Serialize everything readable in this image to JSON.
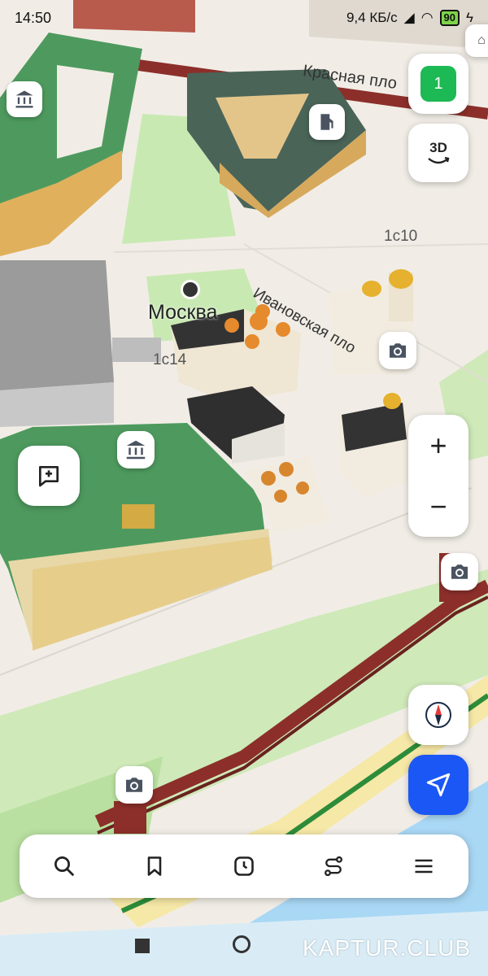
{
  "status_bar": {
    "time": "14:50",
    "network_speed": "9,4 КБ/с",
    "battery": "90"
  },
  "map": {
    "labels": {
      "krasnaya_square": "Красная пло",
      "ivanovskaya_square": "Ивановская пло",
      "building_1c10": "1с10",
      "building_1c14": "1с14",
      "moskva": "Москва"
    }
  },
  "controls": {
    "notifications_count": "1",
    "mode_3d": "3D",
    "zoom_in": "+",
    "zoom_out": "−"
  },
  "colors": {
    "accent": "#1a57f5",
    "badge_green": "#1db954",
    "roof_green": "#4e9a5e",
    "wall_red": "#8c2f2a",
    "river": "#a9d8f5"
  },
  "bottom_nav": {
    "items": [
      "search-icon",
      "bookmark-icon",
      "history-icon",
      "route-icon",
      "menu-icon"
    ]
  },
  "watermark": "KAPTUR.CLUB"
}
